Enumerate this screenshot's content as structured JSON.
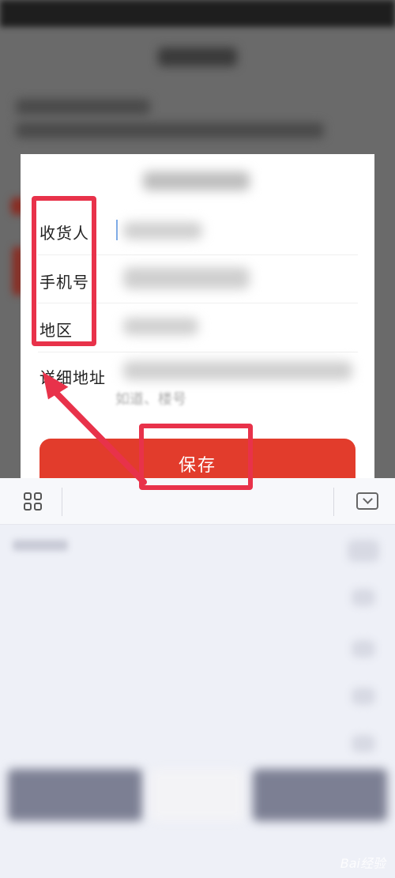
{
  "dialog": {
    "rows": [
      {
        "label": "收货人"
      },
      {
        "label": "手机号"
      },
      {
        "label": "地区"
      },
      {
        "label": "详细地址"
      }
    ],
    "address_hint": "如道、楼号",
    "save_label": "保存"
  },
  "keyboard": {
    "toolbar_left_icon": "grid-icon",
    "toolbar_right_icon": "keyboard-collapse-icon"
  },
  "watermark": "Bai经验",
  "colors": {
    "accent_red": "#e23c2c",
    "annotation_red": "#e8324a"
  }
}
